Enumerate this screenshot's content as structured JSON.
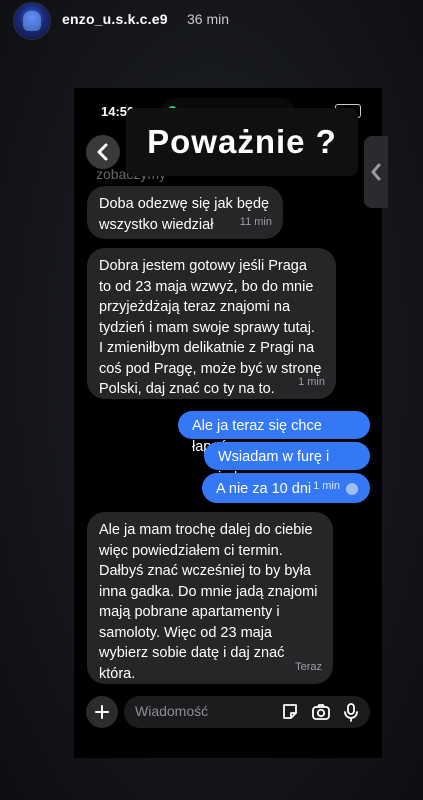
{
  "story": {
    "username": "enzo_u.s.k.c.e9",
    "time_ago": "36 min"
  },
  "status_bar": {
    "time": "14:50"
  },
  "sticker": {
    "text": "Poważnie ?"
  },
  "partial_text": "zobaczymy",
  "messages": [
    {
      "direction": "incoming",
      "text": "Doba odezwę się jak będę\nwszystko wiedział",
      "time": "11 min"
    },
    {
      "direction": "incoming",
      "text": "Dobra jestem gotowy jeśli Praga\nto od 23 maja wzwyż, bo do mnie\nprzyjeżdżają teraz znajomi na\ntydzień i mam swoje sprawy tutaj.\nI zmieniłbym delikatnie z Pragi na\ncoś pod Pragę, może być w stronę\nPolski, daj znać co ty na to.",
      "time": "1 min"
    },
    {
      "direction": "outgoing",
      "text": "Ale ja teraz się chce łapać"
    },
    {
      "direction": "outgoing",
      "text": "Wsiadam w furę i jadę"
    },
    {
      "direction": "outgoing",
      "text": "A nie za 10 dni",
      "time": "1 min"
    },
    {
      "direction": "incoming",
      "text": "Ale ja mam trochę dalej do ciebie\nwięc powiedziałem ci termin.\nDałbyś znać wcześniej to by była\ninna gadka. Do mnie jadą znajomi\nmają pobrane apartamenty i\nsamoloty. Więc od 23 maja\nwybierz sobie datę i daj znać\nktóra.",
      "time": "Teraz"
    }
  ],
  "composer": {
    "placeholder": "Wiadomość"
  },
  "colors": {
    "outgoing_bubble": "#3478f6",
    "incoming_bubble": "#262629",
    "background": "#000000"
  }
}
